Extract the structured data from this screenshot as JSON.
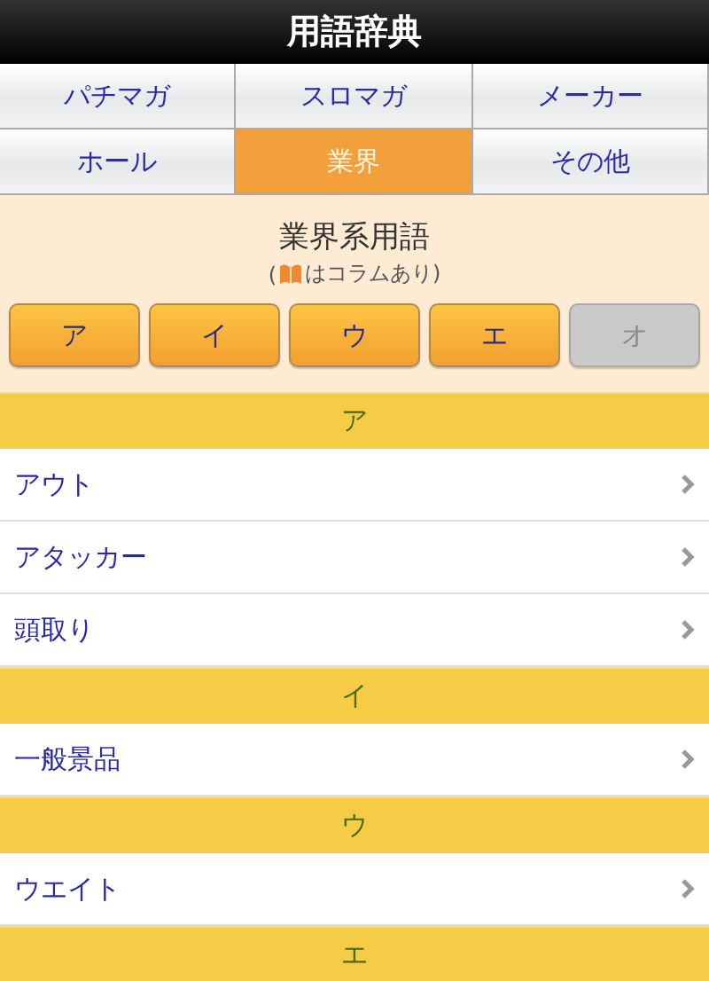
{
  "title": "用語辞典",
  "tabs": [
    {
      "label": "パチマガ",
      "selected": false
    },
    {
      "label": "スロマガ",
      "selected": false
    },
    {
      "label": "メーカー",
      "selected": false
    },
    {
      "label": "ホール",
      "selected": false
    },
    {
      "label": "業界",
      "selected": true
    },
    {
      "label": "その他",
      "selected": false
    }
  ],
  "heading": {
    "title": "業界系用語",
    "note_open": "(",
    "note_rest": "はコラムあり)"
  },
  "index_buttons": [
    {
      "label": "ア",
      "disabled": false
    },
    {
      "label": "イ",
      "disabled": false
    },
    {
      "label": "ウ",
      "disabled": false
    },
    {
      "label": "エ",
      "disabled": false
    },
    {
      "label": "オ",
      "disabled": true
    }
  ],
  "sections": [
    {
      "heading": "ア",
      "items": [
        {
          "label": "アウト"
        },
        {
          "label": "アタッカー"
        },
        {
          "label": "頭取り"
        }
      ]
    },
    {
      "heading": "イ",
      "items": [
        {
          "label": "一般景品"
        }
      ]
    },
    {
      "heading": "ウ",
      "items": [
        {
          "label": "ウエイト"
        }
      ]
    },
    {
      "heading": "エ"
    }
  ]
}
